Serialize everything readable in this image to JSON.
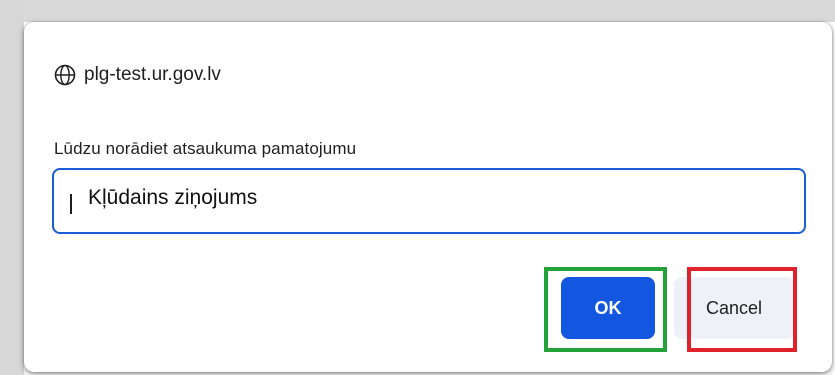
{
  "dialog": {
    "origin": "plg-test.ur.gov.lv",
    "origin_icon": "globe-icon",
    "prompt_label": "Lūdzu norādiet atsaukuma pamatojumu",
    "input_value": "Kļūdains ziņojums",
    "ok_label": "OK",
    "cancel_label": "Cancel"
  },
  "colors": {
    "primary": "#1356e0",
    "input_focus_border": "#1a5bd6",
    "ok_highlight": "#23a23a",
    "cancel_highlight": "#e0222a"
  }
}
